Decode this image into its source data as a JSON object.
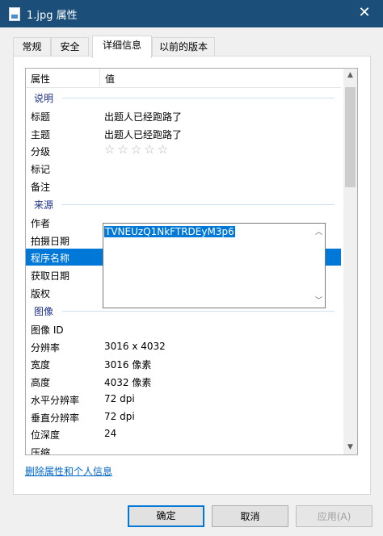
{
  "window": {
    "title": "1.jpg 属性",
    "close_glyph": "✕"
  },
  "tabs": [
    {
      "label": "常规"
    },
    {
      "label": "安全"
    },
    {
      "label": "详细信息"
    },
    {
      "label": "以前的版本"
    }
  ],
  "details": {
    "header": {
      "property": "属性",
      "value": "值"
    },
    "groups": {
      "description": "说明",
      "origin": "来源",
      "image": "图像"
    },
    "rows": {
      "title": {
        "key": "标题",
        "value": "出题人已经跑路了"
      },
      "subject": {
        "key": "主题",
        "value": "出题人已经跑路了"
      },
      "rating": {
        "key": "分级",
        "stars": "☆☆☆☆☆"
      },
      "tags": {
        "key": "标记",
        "value": ""
      },
      "comments": {
        "key": "备注",
        "value": ""
      },
      "authors": {
        "key": "作者",
        "value": ""
      },
      "date_taken": {
        "key": "拍摄日期",
        "value": ""
      },
      "program_name": {
        "key": "程序名称",
        "value": ""
      },
      "date_acquired": {
        "key": "获取日期",
        "value": ""
      },
      "copyright": {
        "key": "版权",
        "value": ""
      },
      "image_id": {
        "key": "图像 ID",
        "value": ""
      },
      "dimensions": {
        "key": "分辨率",
        "value": "3016 x 4032"
      },
      "width": {
        "key": "宽度",
        "value": "3016 像素"
      },
      "height": {
        "key": "高度",
        "value": "4032 像素"
      },
      "hres": {
        "key": "水平分辨率",
        "value": "72 dpi"
      },
      "vres": {
        "key": "垂直分辨率",
        "value": "72 dpi"
      },
      "bit_depth": {
        "key": "位深度",
        "value": "24"
      },
      "compression": {
        "key": "压缩",
        "value": ""
      }
    },
    "comment_editor": {
      "text": "TVNEUzQ1NkFTRDEyM3p6"
    },
    "remove_link": "删除属性和个人信息"
  },
  "buttons": {
    "ok": "确定",
    "cancel": "取消",
    "apply": "应用(A)"
  },
  "colors": {
    "titlebar": "#1b4f7a",
    "selection": "#0078d7",
    "link": "#0066cc"
  }
}
